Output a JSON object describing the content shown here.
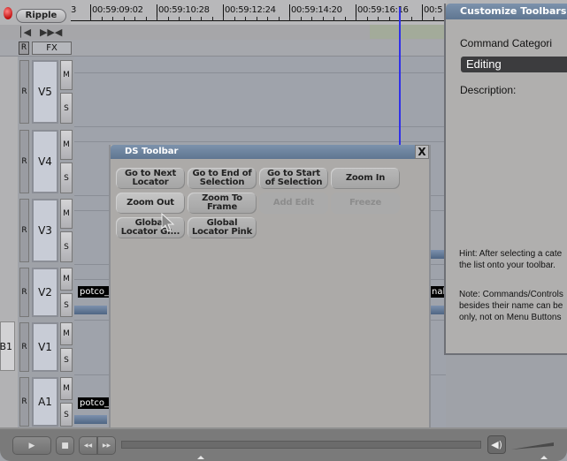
{
  "timeline": {
    "mode_button": "Ripple",
    "timecodes": [
      "3",
      "00:59:09:02",
      "00:59:10:28",
      "00:59:12:24",
      "00:59:14:20",
      "00:59:16:16",
      "00:5"
    ],
    "nav_icons": [
      "step-back-icon",
      "step-forward-icon",
      "trim-icon"
    ],
    "fx_header": {
      "r": "R",
      "fx": "FX"
    },
    "tracks": [
      {
        "name": "V5",
        "r": "R",
        "m": "M",
        "s": "S"
      },
      {
        "name": "V4",
        "r": "R",
        "m": "M",
        "s": "S"
      },
      {
        "name": "V3",
        "r": "R",
        "m": "M",
        "s": "S"
      },
      {
        "name": "V2",
        "r": "R",
        "m": "M",
        "s": "S"
      },
      {
        "name": "V1",
        "r": "R",
        "m": "M",
        "s": "S"
      },
      {
        "name": "A1",
        "r": "R",
        "m": "M",
        "s": "S"
      }
    ],
    "source_tab": "B1",
    "clips": {
      "v2_left": "potco_",
      "v2_right": "nal_",
      "a1_left": "potco_"
    }
  },
  "ds_toolbar": {
    "title": "DS Toolbar",
    "close": "X",
    "buttons": [
      {
        "label_line1": "Go to Next",
        "label_line2": "Locator",
        "state": "normal"
      },
      {
        "label_line1": "Go to End of",
        "label_line2": "Selection",
        "state": "normal"
      },
      {
        "label_line1": "Go to Start",
        "label_line2": "of Selection",
        "state": "normal"
      },
      {
        "label_line1": "Zoom In",
        "label_line2": "",
        "state": "normal"
      },
      {
        "label_line1": "Zoom Out",
        "label_line2": "",
        "state": "hover"
      },
      {
        "label_line1": "Zoom To",
        "label_line2": "Frame",
        "state": "normal"
      },
      {
        "label_line1": "Add Edit",
        "label_line2": "",
        "state": "disabled"
      },
      {
        "label_line1": "Freeze",
        "label_line2": "",
        "state": "disabled"
      },
      {
        "label_line1": "Global",
        "label_line2": "Locator Gr...",
        "state": "normal"
      },
      {
        "label_line1": "Global",
        "label_line2": "Locator Pink",
        "state": "normal"
      }
    ]
  },
  "customize_toolbars": {
    "title": "Customize Toolbars",
    "category_label": "Command Categori",
    "category_value": "Editing",
    "description_label": "Description:",
    "hint_line1": "Hint: After selecting a cate",
    "hint_line2": "the list onto your toolbar.",
    "note_line1": "Note: Commands/Controls",
    "note_line2": "besides their name can be",
    "note_line3": "only, not on Menu Buttons"
  },
  "transport": {
    "play": "▶",
    "stop": "■",
    "rewind": "◀◀",
    "fast_forward": "▶▶",
    "volume_icon": "🔊"
  },
  "colors": {
    "title_bar": "#6a819c",
    "playhead": "#3030e8",
    "clip_label_bg": "#000000",
    "dropdown_bg": "#3c3c3e"
  }
}
